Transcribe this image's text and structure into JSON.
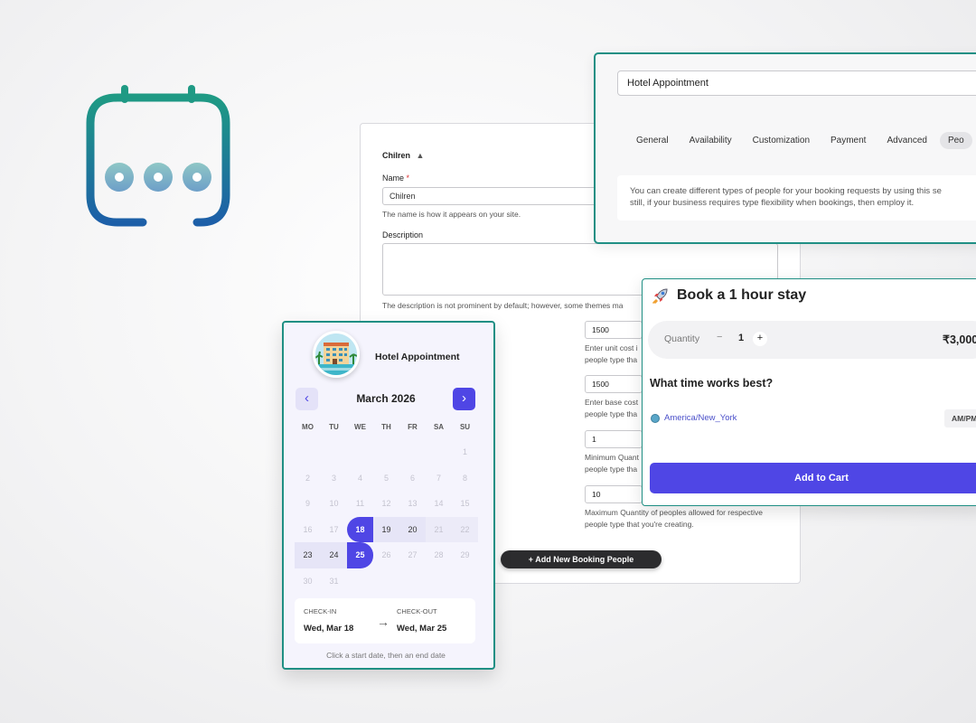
{
  "form": {
    "section_title": "Chilren",
    "section_toggle": "▲",
    "name_label": "Name",
    "required_mark": "*",
    "name_value": "Chilren",
    "name_help": "The name is how it appears on your site.",
    "description_label": "Description",
    "description_help": "The description is not prominent by default; however, some themes ma",
    "unit_cost_value": "1500",
    "unit_cost_help": "Enter unit cost i\npeople type tha",
    "base_cost_value": "1500",
    "base_cost_help": "Enter base cost\npeople type tha",
    "min_qty_value": "1",
    "min_qty_help": "Minimum Quant\npeople type tha",
    "max_qty_value": "10",
    "max_qty_help": "Maximum Quantity of peoples allowed for respective people type that you're creating.",
    "add_people_label": "+ Add New Booking People"
  },
  "settings": {
    "title_value": "Hotel Appointment",
    "tabs": [
      "General",
      "Availability",
      "Customization",
      "Payment",
      "Advanced",
      "Peo"
    ],
    "active_tab": "Peo",
    "note": "You can create different types of people for your booking requests by using this se\nstill, if your business requires type flexibility when bookings, then employ it."
  },
  "booking": {
    "icon": "rocket-icon",
    "title": "Book a 1 hour stay",
    "quantity_label": "Quantity",
    "quantity_minus": "−",
    "quantity_value": "1",
    "quantity_plus": "+",
    "price": "₹3,000",
    "question": "What time works best?",
    "timezone": "America/New_York",
    "ampm": "AM/PM",
    "add_to_cart": "Add to Cart"
  },
  "calendar": {
    "hotel_name": "Hotel Appointment",
    "month": "March 2026",
    "prev": "‹",
    "next": "›",
    "weekdays": [
      "MO",
      "TU",
      "WE",
      "TH",
      "FR",
      "SA",
      "SU"
    ],
    "checkin_label": "CHECK-IN",
    "checkin_value": "Wed, Mar 18",
    "arrow": "→",
    "checkout_label": "CHECK-OUT",
    "checkout_value": "Wed, Mar 25",
    "hint": "Click a start date, then an end date",
    "accent": "#4f46e5",
    "border_color": "#1f8f84"
  }
}
